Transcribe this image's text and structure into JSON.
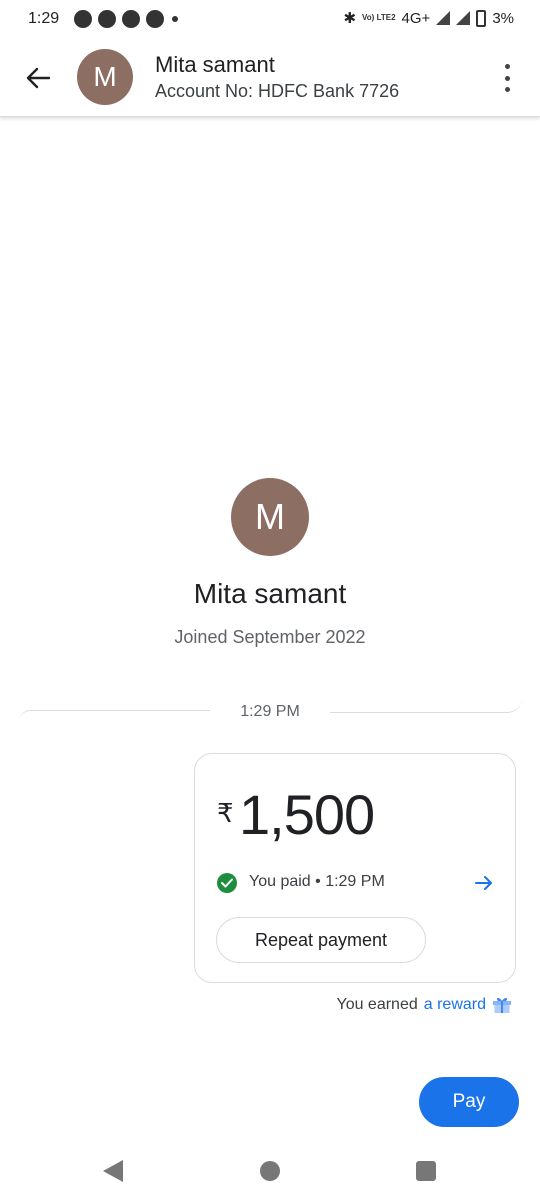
{
  "status_bar": {
    "time": "1:29",
    "network": "4G+",
    "volte": "Vo) LTE2",
    "battery": "3%"
  },
  "header": {
    "avatar_letter": "M",
    "name": "Mita samant",
    "account": "Account No: HDFC Bank 7726"
  },
  "profile": {
    "avatar_letter": "M",
    "name": "Mita samant",
    "joined": "Joined September 2022"
  },
  "chat": {
    "timestamp": "1:29 PM",
    "payment": {
      "currency_symbol": "₹",
      "amount": "1,500",
      "status": "You paid • 1:29 PM",
      "repeat_label": "Repeat payment"
    },
    "reward_prefix": "You earned",
    "reward_link": "a reward"
  },
  "pay_button": "Pay",
  "colors": {
    "accent": "#1a73e8",
    "avatar": "#8d6e63",
    "success": "#1e8e3e"
  }
}
